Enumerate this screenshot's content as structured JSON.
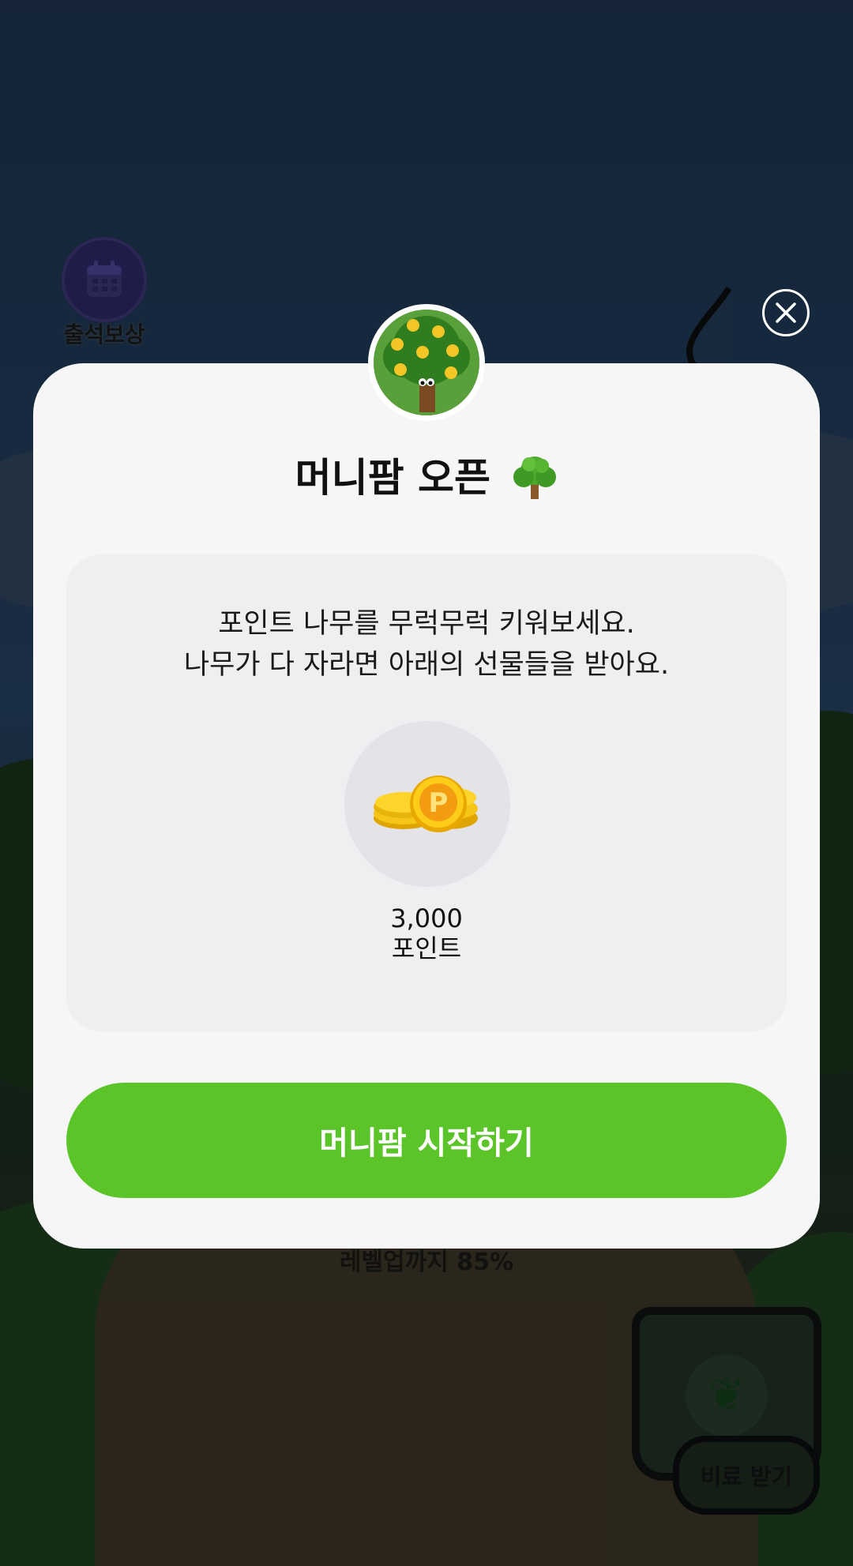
{
  "background": {
    "attendance_label": "출석보상",
    "level_progress_text": "레벨업까지 85%",
    "fertilizer_button_label": "비료 받기"
  },
  "modal": {
    "title": "머니팜 오픈",
    "title_emoji": "🌳",
    "description_line1": "포인트 나무를 무럭무럭 키워보세요.",
    "description_line2": "나무가 다 자라면 아래의 선물들을 받아요.",
    "reward_amount": "3,000",
    "reward_unit": "포인트",
    "start_button_label": "머니팜 시작하기"
  },
  "colors": {
    "primary_green": "#5ac428",
    "modal_bg": "#f6f6f6",
    "card_bg": "#efeff1"
  },
  "icons": [
    "calendar-icon",
    "close-icon",
    "money-tree-avatar",
    "tree-emoji-icon",
    "point-coins-icon",
    "seedling-icon"
  ]
}
